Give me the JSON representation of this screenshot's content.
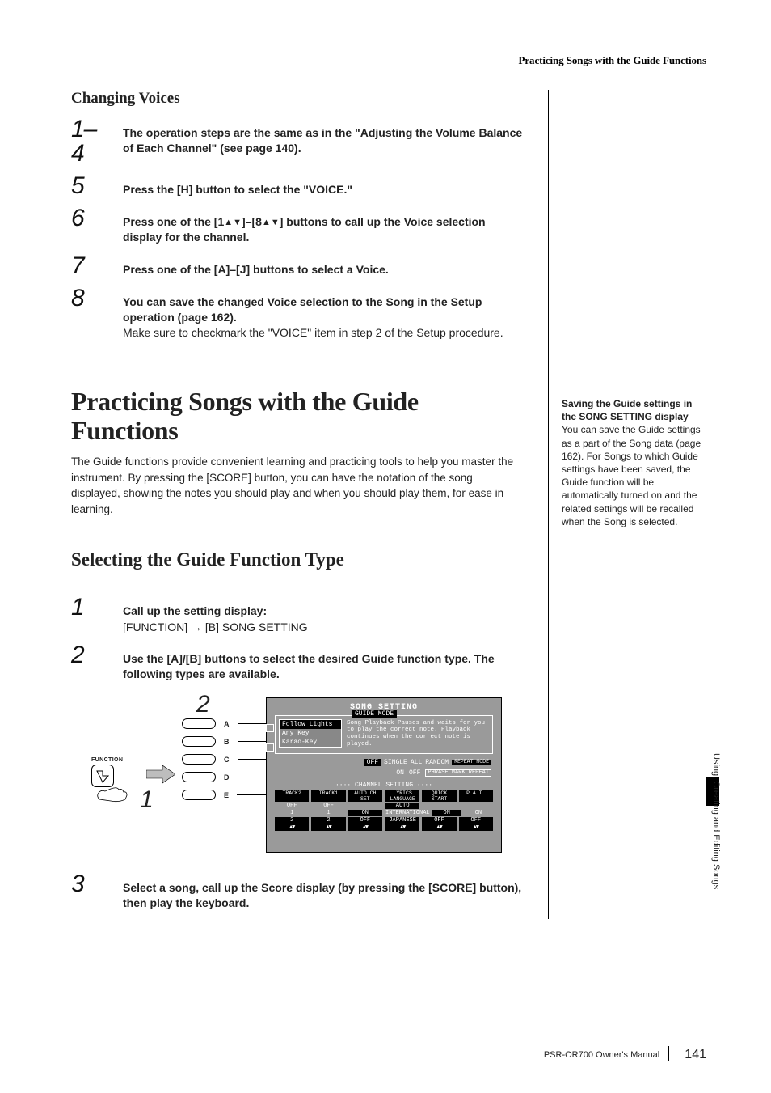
{
  "running_head": "Practicing Songs with the Guide Functions",
  "changing_voices": {
    "title": "Changing Voices",
    "steps": {
      "s1_num": "1–4",
      "s1": "The operation steps are the same as in the \"Adjusting the Volume Balance of Each Channel\" (see page 140).",
      "s5_num": "5",
      "s5": "Press the [H] button to select the \"VOICE.\"",
      "s6_num": "6",
      "s6_a": "Press one of the [1",
      "s6_b": "]–[8",
      "s6_c": "] buttons to call up the Voice selection display for the channel.",
      "s7_num": "7",
      "s7": "Press one of the [A]–[J] buttons to select a Voice.",
      "s8_num": "8",
      "s8_bold": "You can save the changed Voice selection to the Song in the Setup operation (page 162).",
      "s8_light": "Make sure to checkmark the \"VOICE\" item in step 2 of the Setup procedure."
    }
  },
  "guide_section": {
    "title": "Practicing Songs with the Guide Functions",
    "intro": "The Guide functions provide convenient learning and practicing tools to help you master the instrument. By pressing the [SCORE] button, you can have the notation of the song displayed, showing the notes you should play and when you should play them, for ease in learning.",
    "subsection_title": "Selecting the Guide Function Type",
    "steps": {
      "s1_num": "1",
      "s1_bold": "Call up the setting display:",
      "s1_light": "[FUNCTION] → [B] SONG SETTING",
      "s2_num": "2",
      "s2": "Use the [A]/[B] buttons to select the desired Guide function type. The following types are available.",
      "s3_num": "3",
      "s3": "Select a song, call up the Score display (by pressing the [SCORE] button), then play the keyboard."
    }
  },
  "figure": {
    "function_label": "FUNCTION",
    "panel_labels": [
      "A",
      "B",
      "C",
      "D",
      "E"
    ],
    "callout_1": "1",
    "callout_2": "2",
    "screen": {
      "title": "SONG SETTING",
      "guide_mode_label": "GUIDE MODE",
      "list": [
        "Follow Lights",
        "Any Key",
        "Karao-Key"
      ],
      "desc": "Song Playback Pauses and waits for you to play the correct note. Playback continues when the correct note is played.",
      "repeat_row": {
        "off": "OFF",
        "single": "SINGLE",
        "all": "ALL",
        "random": "RANDOM",
        "label": "REPEAT MODE"
      },
      "phrase_row": {
        "on": "ON",
        "off": "OFF",
        "label": "PHRASE MARK REPEAT"
      },
      "channel_title": "···· CHANNEL SETTING ····",
      "left_group": {
        "headers": [
          "TRACK2",
          "TRACK1",
          "AUTO CH SET"
        ],
        "vals": [
          "OFF",
          "OFF",
          ""
        ],
        "nums": [
          "1",
          "1",
          "ON"
        ],
        "sel": [
          "2",
          "2",
          "OFF"
        ]
      },
      "right_group": {
        "headers": [
          "LYRICS LANGUAGE",
          "QUICK START",
          "P.A.T."
        ],
        "vals": [
          "AUTO",
          "",
          ""
        ],
        "nums": [
          "INTERNATIONAL",
          "ON",
          "ON"
        ],
        "sel": [
          "JAPANESE",
          "OFF",
          "OFF"
        ]
      },
      "tri": "▲▼"
    }
  },
  "side_note": {
    "title": "Saving the Guide settings in the SONG SETTING display",
    "body": "You can save the Guide settings as a part of the Song data (page 162). For Songs to which Guide settings have been saved, the Guide function will be automatically turned on and the related settings will be recalled when the Song is selected."
  },
  "side_tab": "Using, Creating and Editing Songs",
  "footer": {
    "manual": "PSR-OR700 Owner's Manual",
    "page": "141"
  }
}
